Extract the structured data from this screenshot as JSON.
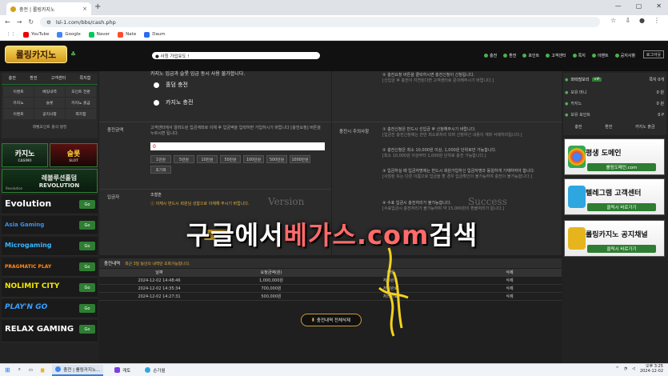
{
  "browser": {
    "tab_title": "충전 | 롤링카지노",
    "url": "lsl-1.com/bbs/cash.php",
    "bookmarks": [
      "YouTube",
      "Google",
      "Naver",
      "Nate",
      "Daum"
    ]
  },
  "header": {
    "logo": "롤링카지노",
    "marquee": "● 사칭 가입유도 !",
    "nav": [
      "충전",
      "환전",
      "포인트",
      "고객센터",
      "쪽지",
      "이벤트",
      "공지사항"
    ],
    "logout": "로그아웃"
  },
  "left_nav": {
    "top": [
      "충전",
      "환전",
      "고객센터",
      "쪽지함"
    ],
    "grid": [
      "이벤트",
      "베팅내역",
      "포인트 전환",
      "카지노",
      "슬롯",
      "카지노 출금",
      "이벤트",
      "공지사항",
      "쪽지함"
    ],
    "wide": "레벨포인트 출석 랭킹"
  },
  "banners": {
    "casino": "카지노",
    "casino_sub": "CASINO",
    "slot": "슬롯",
    "slot_sub": "SLOT",
    "revolution": "레볼루션홀덤",
    "revolution_sub": "REVOLUTION",
    "revolution_small": "Revolution"
  },
  "providers": [
    {
      "name": "Evolution",
      "color": "#ffffff"
    },
    {
      "name": "Asia Gaming",
      "color": "#3a8ff0"
    },
    {
      "name": "Microgaming",
      "color": "#39b5ff"
    },
    {
      "name": "PRAGMATIC PLAY",
      "color": "#ff8a1c"
    },
    {
      "name": "NOLIMIT CITY",
      "color": "#f5e800"
    },
    {
      "name": "PLAY'N GO",
      "color": "#3aa0ff"
    },
    {
      "name": "RELAX GAMING",
      "color": "#ffffff"
    }
  ],
  "provider_go": "Go",
  "form": {
    "header_text": "카지노 입금과 슬롯 입금 동시 사용 불가합니다.",
    "option1": "홀덤 충전",
    "option2": "카지노 충전",
    "amount_label": "충전금액",
    "amount_note": "고객센터에서 알려드린 입금계좌로 이체 후 입금액을 입력하면 가입하시기 바랍니다 [충전요청] 버튼을 누르시면 됩니다.",
    "amount_value": "0",
    "amount_buttons": [
      "1만원",
      "5만원",
      "10만원",
      "50만원",
      "100만원",
      "500만원",
      "1000만원",
      "초기화"
    ],
    "depositor_label": "입금자",
    "depositor_value": "조철훈",
    "depositor_note": "ⓘ 이체시 반드시 회원님 성함으로 이체해 주시기 바랍니다.",
    "submit": "충전요청"
  },
  "info": {
    "top_item1": "② 충전요청 버튼을 클릭하시면 충전신청이 신청됩니다.",
    "top_item1_sub": "[신입금 후 충전이 지연된다면 고객센터로 문의해주시기 바랍니다.]",
    "section_label": "충전시 주의사항",
    "items": [
      {
        "text": "① 충전신청은 반드시 선입금 후 신청해주시기 바랍니다.",
        "sub": "[입금전 충전신청에는 한번 최소화처리 되며 신청하신 내용이 계좌 삭제처리됩니다.]"
      },
      {
        "text": "② 충전신청은 최소 10,000원 이상, 1,000원 단위로만 가능합니다.",
        "sub": "[최소 10,000원 이상부터 1,000원 단위로 충전 가능합니다.]"
      },
      {
        "text": "③ 입금하실 때 입금자명에는 반드시 회원가입하신 입금자명과 동일하게 기재하여야 합니다.",
        "sub": "[사칭된 또는 다른 이름으로 입금을 할 경우 입금확인이 불가능하여 충전이 불가능합니다.]"
      },
      {
        "text": "④ 수표 입금시 충전처리가 불가능합니다.",
        "sub": "[수표입금시 충전처리가 불가능하며 약 15,000원의 환불처리가 됩니다.]"
      }
    ]
  },
  "history": {
    "title": "충전내역",
    "subtitle": "최근 3일 동안의 내역만 조회가능합니다.",
    "columns": [
      "날짜",
      "요청금액(원)",
      "상태",
      "삭제"
    ],
    "rows": [
      {
        "date": "2024-12-02 14:48:46",
        "amount": "1,000,000원",
        "status": "처리완료",
        "delete": "삭제"
      },
      {
        "date": "2024-12-02 14:35:34",
        "amount": "700,000원",
        "status": "처리완료",
        "delete": "삭제"
      },
      {
        "date": "2024-12-02 14:27:31",
        "amount": "500,000원",
        "status": "처리완료",
        "delete": "삭제"
      }
    ],
    "delete_all": "충전내역 전체삭제"
  },
  "right": {
    "user": "와따많보리",
    "vip": "VIP",
    "msg": "쪽지 0개",
    "rows": [
      {
        "label": "보유 머니",
        "value": "0 원"
      },
      {
        "label": "카지노",
        "value": "0 원"
      },
      {
        "label": "보유 포인트",
        "value": "0 P"
      }
    ],
    "nav": [
      "충전",
      "환전",
      "카지노 출금"
    ],
    "banners": [
      {
        "title": "평생 도메인",
        "cta": "롤링도메인.com",
        "color": "#3aa34a"
      },
      {
        "title": "텔레그램 고객센터",
        "cta": "클릭시 바로가기",
        "color": "#2ea6e0"
      },
      {
        "title": "롤링카지노 공지채널",
        "cta": "클릭시 바로가기",
        "color": "#e6b51e"
      }
    ]
  },
  "watermark": {
    "main1": "구글에서 ",
    "main2": "베가스.com",
    "main3": " 검색",
    "version": "Version",
    "success": "Success"
  },
  "taskbar": {
    "apps": [
      "충전 | 롤링카지노...",
      "캐토",
      "손가월"
    ],
    "time": "오후 3:25",
    "date": "2024-12-02"
  }
}
